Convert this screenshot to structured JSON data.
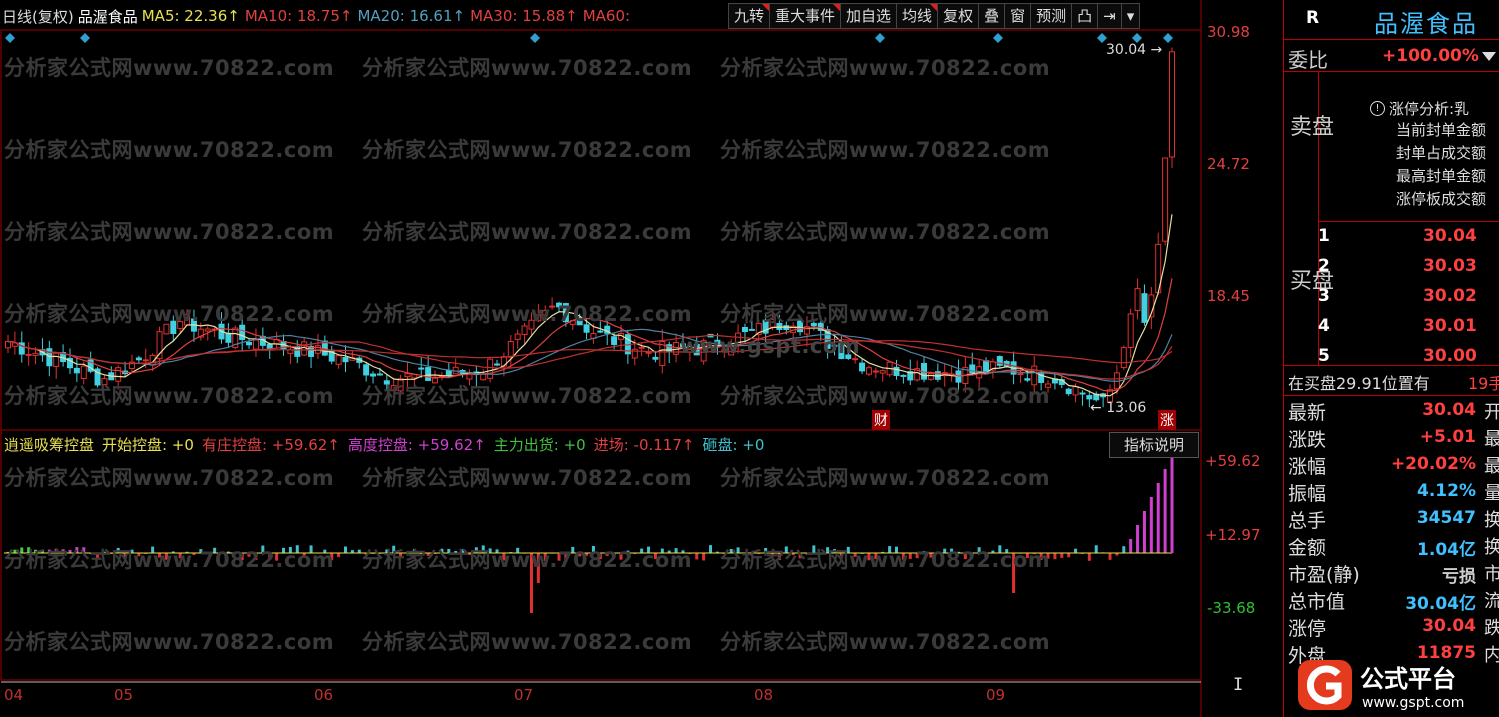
{
  "header": {
    "period": "日线(复权)",
    "stock": "品渥食品",
    "ma": [
      {
        "label": "MA5: 22.36↑",
        "color": "#e8e050"
      },
      {
        "label": "MA10: 18.75↑",
        "color": "#e04040"
      },
      {
        "label": "MA20: 16.61↑",
        "color": "#50a0c0"
      },
      {
        "label": "MA30: 15.88↑",
        "color": "#e04040"
      },
      {
        "label": "MA60:",
        "color": "#e04040"
      }
    ]
  },
  "toolbar": [
    "九转",
    "重大事件",
    "加自选",
    "均线",
    "复权",
    "叠",
    "窗",
    "预测",
    "凸",
    "⇥",
    "▾"
  ],
  "price_axis": [
    "30.98",
    "24.72",
    "18.45"
  ],
  "ind_axis": [
    "+59.62",
    "+12.97",
    "-33.68"
  ],
  "x_axis": [
    "04",
    "05",
    "06",
    "07",
    "08",
    "09"
  ],
  "markers": {
    "high": "30.04",
    "low": "13.06",
    "cai": "财",
    "zhang": "涨"
  },
  "watermark": "分析家公式网www.70822.com",
  "watermark2": "www.gspt.com",
  "indicator": {
    "name": "逍遥吸筹控盘",
    "items": [
      {
        "label": "开始控盘: +0",
        "color": "#e8e050"
      },
      {
        "label": "有庄控盘: +59.62↑",
        "color": "#e04040"
      },
      {
        "label": "高度控盘: +59.62↑",
        "color": "#d040d0"
      },
      {
        "label": "主力出货: +0",
        "color": "#40c040"
      },
      {
        "label": "进场: -0.117↑",
        "color": "#e04040"
      },
      {
        "label": "砸盘: +0",
        "color": "#40c0d0"
      }
    ],
    "button": "指标说明"
  },
  "panel": {
    "code": "R",
    "name": "品渥食品",
    "wb_label": "委比",
    "wb_value": "+100.00%",
    "sell_label": "卖盘",
    "buy_label": "买盘",
    "limit_title": "涨停分析:乳",
    "limit_items": [
      "当前封单金额",
      "封单占成交额",
      "最高封单金额",
      "涨停板成交额"
    ],
    "bids": [
      {
        "n": "1",
        "p": "30.04"
      },
      {
        "n": "2",
        "p": "30.03"
      },
      {
        "n": "3",
        "p": "30.02"
      },
      {
        "n": "4",
        "p": "30.01"
      },
      {
        "n": "5",
        "p": "30.00"
      }
    ],
    "buy_pos": "在买盘29.91位置有",
    "buy_pos_tail": "19手",
    "stats": [
      {
        "k": "最新",
        "v": "30.04",
        "c": "#ff4040",
        "t": "开"
      },
      {
        "k": "涨跌",
        "v": "+5.01",
        "c": "#ff4040",
        "t": "最"
      },
      {
        "k": "涨幅",
        "v": "+20.02%",
        "c": "#ff4040",
        "t": "最"
      },
      {
        "k": "振幅",
        "v": "4.12%",
        "c": "#40c0ff",
        "t": "量"
      },
      {
        "k": "总手",
        "v": "34547",
        "c": "#40c0ff",
        "t": "换"
      },
      {
        "k": "金额",
        "v": "1.04亿",
        "c": "#40c0ff",
        "t": "换"
      },
      {
        "k": "市盈(静)",
        "v": "亏损",
        "c": "#cccccc",
        "t": "市"
      },
      {
        "k": "总市值",
        "v": "30.04亿",
        "c": "#40c0ff",
        "t": "流"
      },
      {
        "k": "涨停",
        "v": "30.04",
        "c": "#ff4040",
        "t": "跌"
      },
      {
        "k": "外盘",
        "v": "11875",
        "c": "#ff4040",
        "t": "内"
      }
    ]
  },
  "logo": {
    "text": "公式平台",
    "url": "www.gspt.com"
  }
}
